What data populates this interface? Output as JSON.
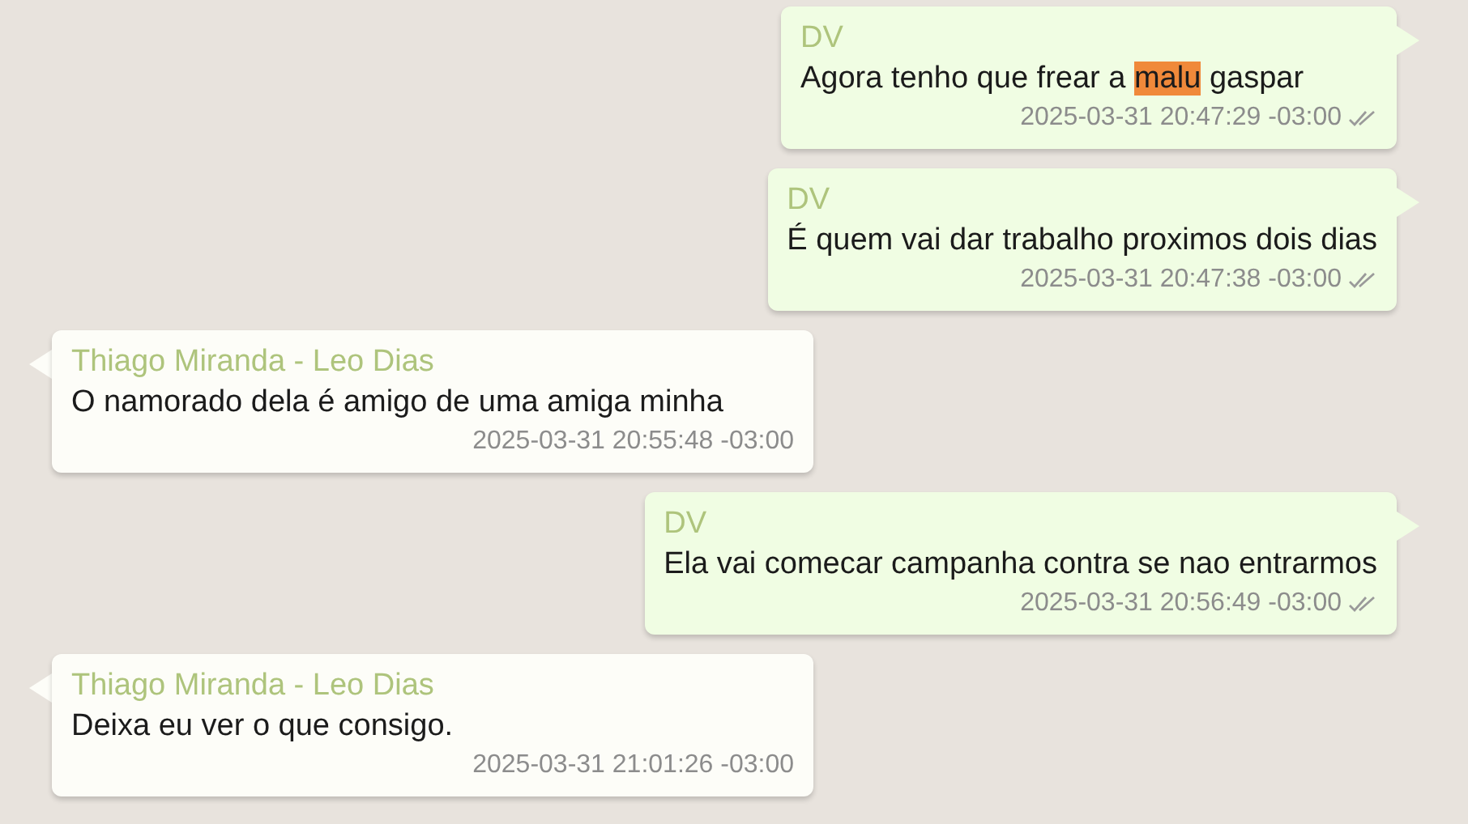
{
  "messages": [
    {
      "kind": "outgoing",
      "sender": "DV",
      "segments": [
        {
          "text": "Agora tenho que frear a ",
          "highlighted": false
        },
        {
          "text": "malu",
          "highlighted": true
        },
        {
          "text": " gaspar",
          "highlighted": false
        }
      ],
      "time": "2025-03-31 20:47:29 -03:00",
      "read": true
    },
    {
      "kind": "outgoing",
      "sender": "DV",
      "segments": [
        {
          "text": "É quem vai dar trabalho proximos dois dias",
          "highlighted": false
        }
      ],
      "time": "2025-03-31 20:47:38 -03:00",
      "read": true
    },
    {
      "kind": "incoming",
      "sender": "Thiago Miranda - Leo Dias",
      "segments": [
        {
          "text": "O namorado dela é amigo de uma amiga minha",
          "highlighted": false
        }
      ],
      "time": "2025-03-31 20:55:48 -03:00"
    },
    {
      "kind": "outgoing",
      "sender": "DV",
      "segments": [
        {
          "text": "Ela vai comecar campanha contra se nao entrarmos",
          "highlighted": false
        }
      ],
      "time": "2025-03-31 20:56:49 -03:00",
      "read": true
    },
    {
      "kind": "incoming",
      "sender": "Thiago Miranda - Leo Dias",
      "segments": [
        {
          "text": "Deixa eu ver o que consigo.",
          "highlighted": false
        }
      ],
      "time": "2025-03-31 21:01:26 -03:00"
    }
  ]
}
